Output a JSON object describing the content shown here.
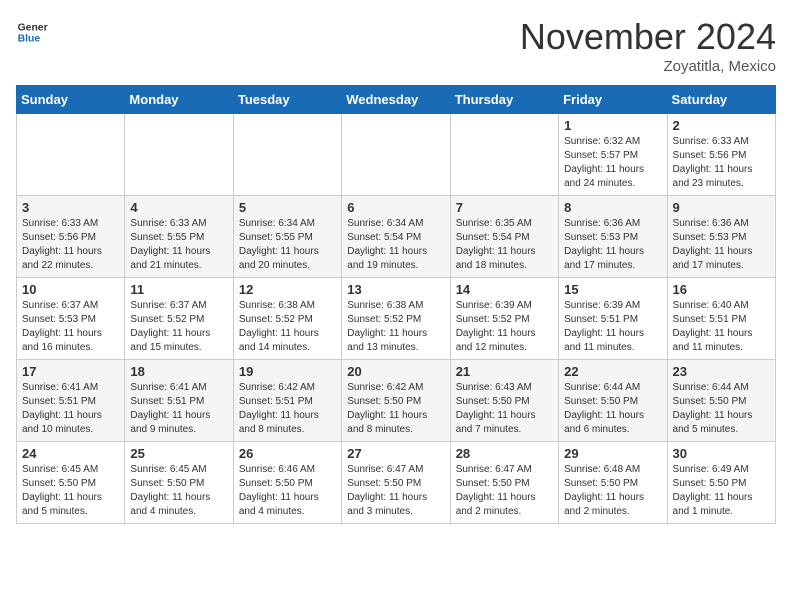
{
  "header": {
    "logo_general": "General",
    "logo_blue": "Blue",
    "month_title": "November 2024",
    "location": "Zoyatitla, Mexico"
  },
  "columns": [
    "Sunday",
    "Monday",
    "Tuesday",
    "Wednesday",
    "Thursday",
    "Friday",
    "Saturday"
  ],
  "weeks": [
    [
      {
        "day": "",
        "info": ""
      },
      {
        "day": "",
        "info": ""
      },
      {
        "day": "",
        "info": ""
      },
      {
        "day": "",
        "info": ""
      },
      {
        "day": "",
        "info": ""
      },
      {
        "day": "1",
        "info": "Sunrise: 6:32 AM\nSunset: 5:57 PM\nDaylight: 11 hours and 24 minutes."
      },
      {
        "day": "2",
        "info": "Sunrise: 6:33 AM\nSunset: 5:56 PM\nDaylight: 11 hours and 23 minutes."
      }
    ],
    [
      {
        "day": "3",
        "info": "Sunrise: 6:33 AM\nSunset: 5:56 PM\nDaylight: 11 hours and 22 minutes."
      },
      {
        "day": "4",
        "info": "Sunrise: 6:33 AM\nSunset: 5:55 PM\nDaylight: 11 hours and 21 minutes."
      },
      {
        "day": "5",
        "info": "Sunrise: 6:34 AM\nSunset: 5:55 PM\nDaylight: 11 hours and 20 minutes."
      },
      {
        "day": "6",
        "info": "Sunrise: 6:34 AM\nSunset: 5:54 PM\nDaylight: 11 hours and 19 minutes."
      },
      {
        "day": "7",
        "info": "Sunrise: 6:35 AM\nSunset: 5:54 PM\nDaylight: 11 hours and 18 minutes."
      },
      {
        "day": "8",
        "info": "Sunrise: 6:36 AM\nSunset: 5:53 PM\nDaylight: 11 hours and 17 minutes."
      },
      {
        "day": "9",
        "info": "Sunrise: 6:36 AM\nSunset: 5:53 PM\nDaylight: 11 hours and 17 minutes."
      }
    ],
    [
      {
        "day": "10",
        "info": "Sunrise: 6:37 AM\nSunset: 5:53 PM\nDaylight: 11 hours and 16 minutes."
      },
      {
        "day": "11",
        "info": "Sunrise: 6:37 AM\nSunset: 5:52 PM\nDaylight: 11 hours and 15 minutes."
      },
      {
        "day": "12",
        "info": "Sunrise: 6:38 AM\nSunset: 5:52 PM\nDaylight: 11 hours and 14 minutes."
      },
      {
        "day": "13",
        "info": "Sunrise: 6:38 AM\nSunset: 5:52 PM\nDaylight: 11 hours and 13 minutes."
      },
      {
        "day": "14",
        "info": "Sunrise: 6:39 AM\nSunset: 5:52 PM\nDaylight: 11 hours and 12 minutes."
      },
      {
        "day": "15",
        "info": "Sunrise: 6:39 AM\nSunset: 5:51 PM\nDaylight: 11 hours and 11 minutes."
      },
      {
        "day": "16",
        "info": "Sunrise: 6:40 AM\nSunset: 5:51 PM\nDaylight: 11 hours and 11 minutes."
      }
    ],
    [
      {
        "day": "17",
        "info": "Sunrise: 6:41 AM\nSunset: 5:51 PM\nDaylight: 11 hours and 10 minutes."
      },
      {
        "day": "18",
        "info": "Sunrise: 6:41 AM\nSunset: 5:51 PM\nDaylight: 11 hours and 9 minutes."
      },
      {
        "day": "19",
        "info": "Sunrise: 6:42 AM\nSunset: 5:51 PM\nDaylight: 11 hours and 8 minutes."
      },
      {
        "day": "20",
        "info": "Sunrise: 6:42 AM\nSunset: 5:50 PM\nDaylight: 11 hours and 8 minutes."
      },
      {
        "day": "21",
        "info": "Sunrise: 6:43 AM\nSunset: 5:50 PM\nDaylight: 11 hours and 7 minutes."
      },
      {
        "day": "22",
        "info": "Sunrise: 6:44 AM\nSunset: 5:50 PM\nDaylight: 11 hours and 6 minutes."
      },
      {
        "day": "23",
        "info": "Sunrise: 6:44 AM\nSunset: 5:50 PM\nDaylight: 11 hours and 5 minutes."
      }
    ],
    [
      {
        "day": "24",
        "info": "Sunrise: 6:45 AM\nSunset: 5:50 PM\nDaylight: 11 hours and 5 minutes."
      },
      {
        "day": "25",
        "info": "Sunrise: 6:45 AM\nSunset: 5:50 PM\nDaylight: 11 hours and 4 minutes."
      },
      {
        "day": "26",
        "info": "Sunrise: 6:46 AM\nSunset: 5:50 PM\nDaylight: 11 hours and 4 minutes."
      },
      {
        "day": "27",
        "info": "Sunrise: 6:47 AM\nSunset: 5:50 PM\nDaylight: 11 hours and 3 minutes."
      },
      {
        "day": "28",
        "info": "Sunrise: 6:47 AM\nSunset: 5:50 PM\nDaylight: 11 hours and 2 minutes."
      },
      {
        "day": "29",
        "info": "Sunrise: 6:48 AM\nSunset: 5:50 PM\nDaylight: 11 hours and 2 minutes."
      },
      {
        "day": "30",
        "info": "Sunrise: 6:49 AM\nSunset: 5:50 PM\nDaylight: 11 hours and 1 minute."
      }
    ]
  ]
}
